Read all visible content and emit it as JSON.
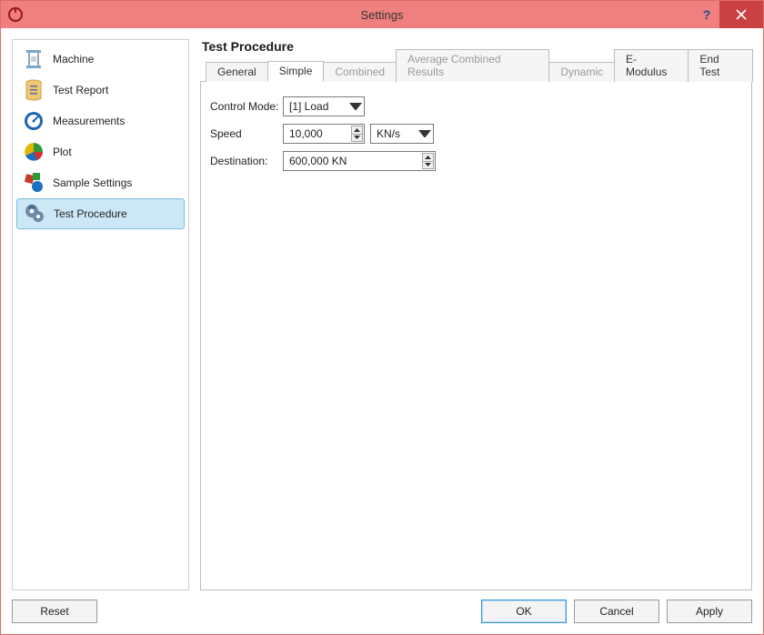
{
  "window": {
    "title": "Settings",
    "help_glyph": "?",
    "close_label": "Close"
  },
  "sidebar": {
    "items": [
      {
        "label": "Machine"
      },
      {
        "label": "Test Report"
      },
      {
        "label": "Measurements"
      },
      {
        "label": "Plot"
      },
      {
        "label": "Sample Settings"
      },
      {
        "label": "Test Procedure"
      }
    ]
  },
  "content": {
    "heading": "Test Procedure",
    "tabs": [
      {
        "label": "General",
        "disabled": false
      },
      {
        "label": "Simple",
        "disabled": false,
        "active": true
      },
      {
        "label": "Combined",
        "disabled": true
      },
      {
        "label": "Average Combined Results",
        "disabled": true
      },
      {
        "label": "Dynamic",
        "disabled": true
      },
      {
        "label": "E-Modulus",
        "disabled": false
      },
      {
        "label": "End Test",
        "disabled": false
      }
    ],
    "form": {
      "control_mode_label": "Control Mode:",
      "control_mode_value": "[1] Load",
      "speed_label": "Speed",
      "speed_value": "10,000",
      "speed_unit": "KN/s",
      "destination_label": "Destination:",
      "destination_value": "600,000 KN"
    }
  },
  "footer": {
    "reset": "Reset",
    "ok": "OK",
    "cancel": "Cancel",
    "apply": "Apply"
  }
}
